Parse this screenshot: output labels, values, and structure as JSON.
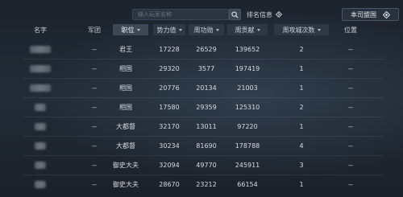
{
  "search": {
    "placeholder": "输入玩家名称"
  },
  "toolbar": {
    "rank_info_label": "排名信息",
    "own_faction_label": "本司盟国"
  },
  "columns": {
    "name": "名字",
    "army": "军团",
    "rank": "职位",
    "power": "势力值",
    "merit": "周功勋",
    "contrib": "周贡献",
    "siege": "周攻城次数",
    "position": "位置"
  },
  "rows": [
    {
      "army": "--",
      "rank": "君王",
      "power": "17228",
      "merit": "26529",
      "contrib": "139652",
      "siege": "2",
      "position": "--"
    },
    {
      "army": "--",
      "rank": "相国",
      "power": "29320",
      "merit": "3577",
      "contrib": "197419",
      "siege": "1",
      "position": "--"
    },
    {
      "army": "--",
      "rank": "相国",
      "power": "20776",
      "merit": "20134",
      "contrib": "21003",
      "siege": "1",
      "position": "--"
    },
    {
      "army": "--",
      "rank": "相国",
      "power": "17580",
      "merit": "29359",
      "contrib": "125310",
      "siege": "2",
      "position": "--"
    },
    {
      "army": "--",
      "rank": "大都督",
      "power": "32170",
      "merit": "13011",
      "contrib": "97220",
      "siege": "1",
      "position": "--"
    },
    {
      "army": "--",
      "rank": "大都督",
      "power": "30234",
      "merit": "81690",
      "contrib": "178788",
      "siege": "4",
      "position": "--"
    },
    {
      "army": "--",
      "rank": "御史大夫",
      "power": "32094",
      "merit": "49770",
      "contrib": "245911",
      "siege": "3",
      "position": "--"
    },
    {
      "army": "--",
      "rank": "御史大夫",
      "power": "28670",
      "merit": "23212",
      "contrib": "66154",
      "siege": "1",
      "position": "--"
    }
  ],
  "icons": {
    "search": "search-icon",
    "rank_info": "diamond-arrow-icon",
    "own_faction": "diamond-icon"
  },
  "colors": {
    "background": "#1c232d",
    "header_active": "#3d4857",
    "text": "#d8dce1"
  }
}
